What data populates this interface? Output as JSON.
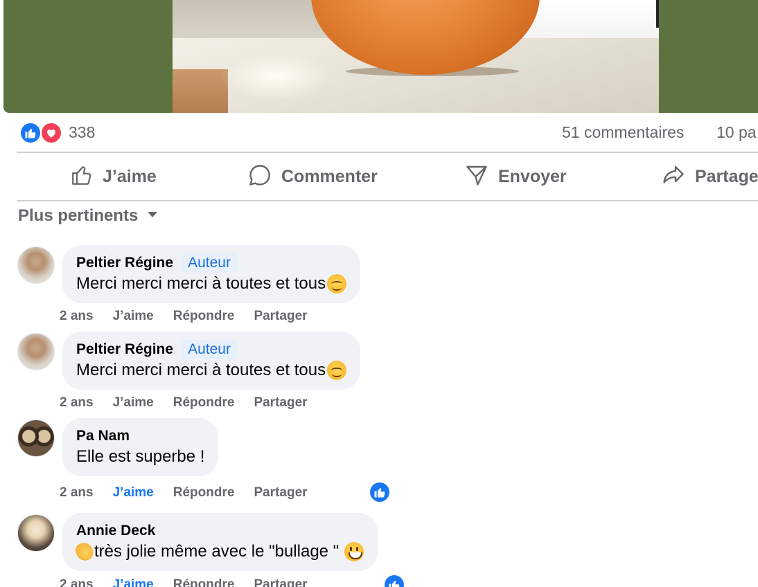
{
  "post": {
    "reactions_count": "338",
    "comments_count": "51 commentaires",
    "shares_count": "10 pa"
  },
  "actions": {
    "like": "J’aime",
    "comment": "Commenter",
    "send": "Envoyer",
    "share": "Partage"
  },
  "sort": {
    "label": "Plus pertinents"
  },
  "comments": [
    {
      "author": "Peltier Régine",
      "badge": "Auteur",
      "text": "Merci merci merci à toutes et tous",
      "time": "2 ans",
      "like": "J’aime",
      "reply": "Répondre",
      "share": "Partager"
    },
    {
      "author": "Peltier Régine",
      "badge": "Auteur",
      "text": "Merci merci merci à toutes et tous",
      "time": "2 ans",
      "like": "J’aime",
      "reply": "Répondre",
      "share": "Partager"
    },
    {
      "author": "Pa Nam",
      "text": "Elle est superbe !",
      "time": "2 ans",
      "like": "J’aime",
      "reply": "Répondre",
      "share": "Partager"
    },
    {
      "author": "Annie Deck",
      "text": "très jolie même avec le \"bullage \"",
      "time": "2 ans",
      "like": "J’aime",
      "reply": "Répondre",
      "share": "Partager"
    }
  ],
  "colors": {
    "accent": "#1877f2",
    "love": "#f33e58",
    "muted_text": "#65676b",
    "bubble": "#f0f2f5",
    "photo_background": "#5c7340"
  }
}
